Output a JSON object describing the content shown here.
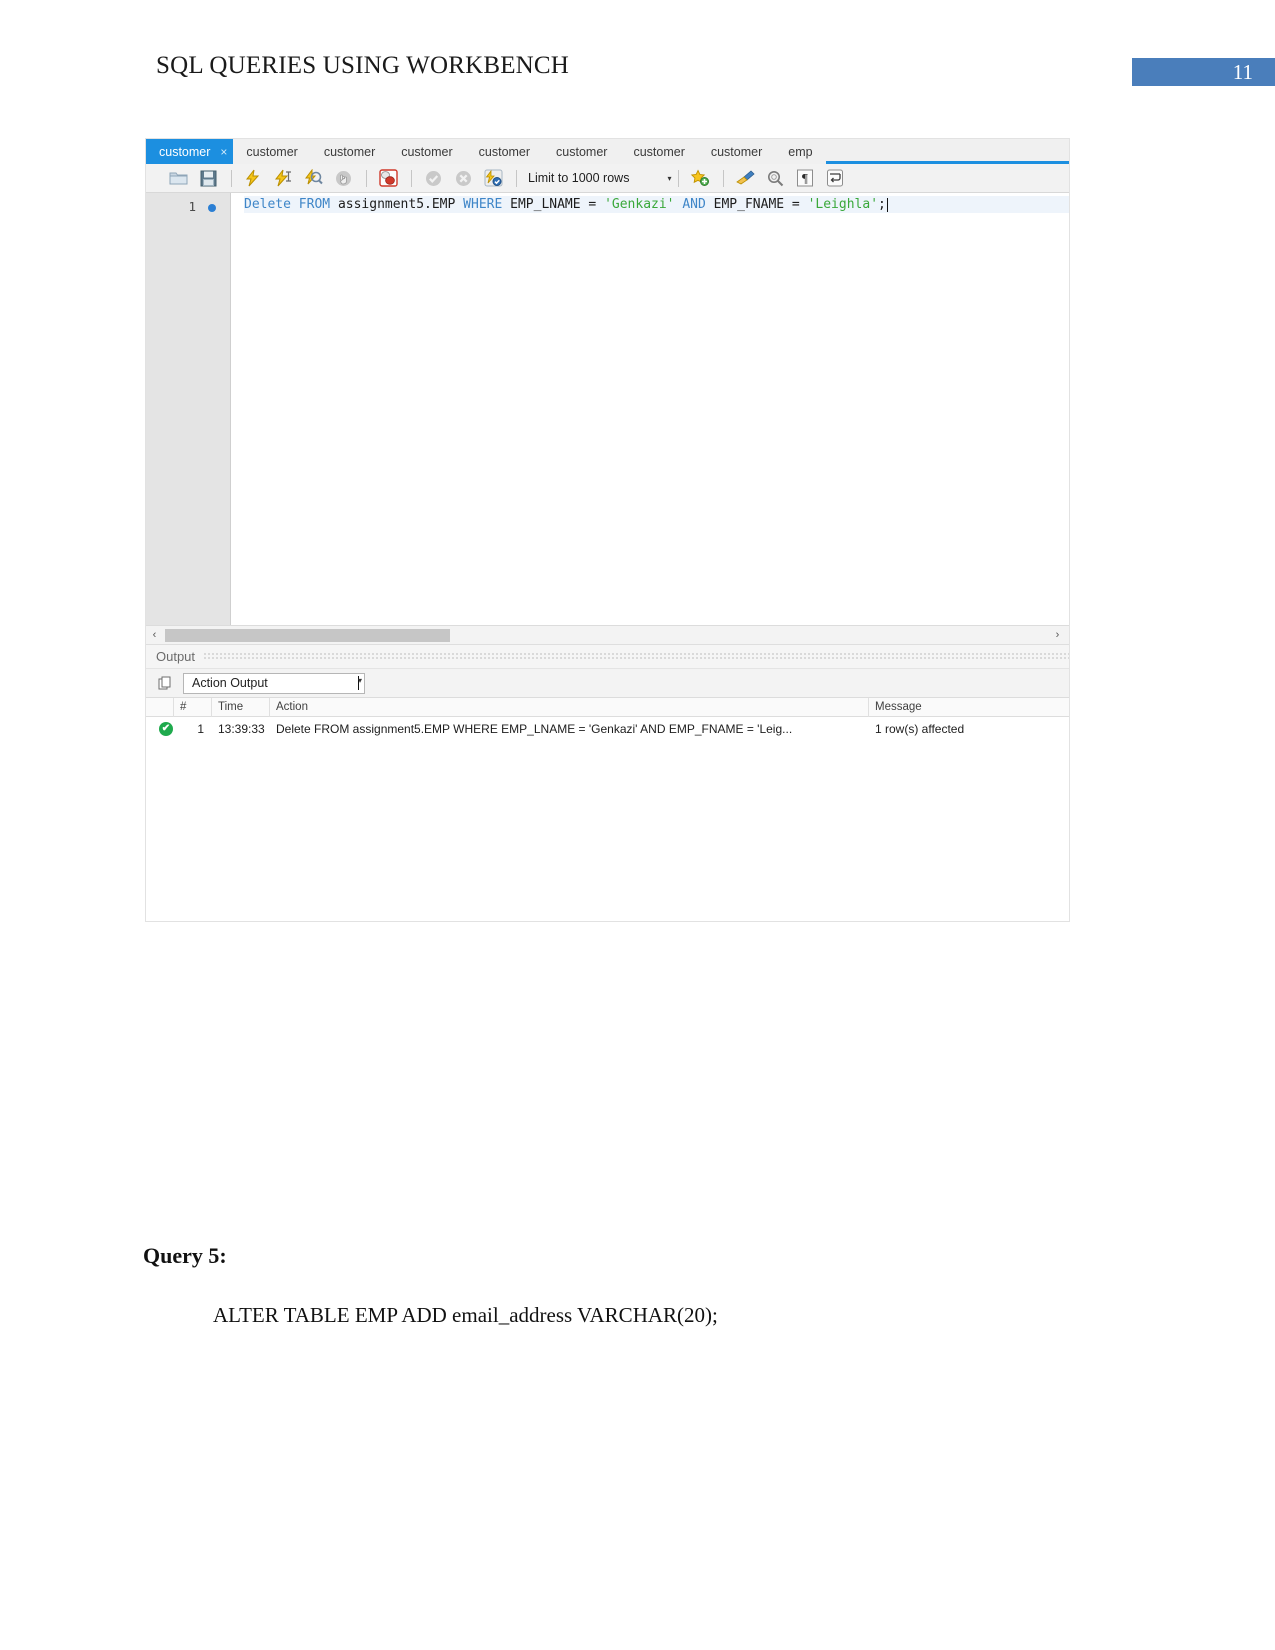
{
  "document": {
    "header_title": "SQL QUERIES USING WORKBENCH",
    "page_number": "11",
    "accent_color": "#4a7ebb",
    "query_label": "Query 5:",
    "query_text": "ALTER TABLE EMP ADD email_address VARCHAR(20);"
  },
  "workbench": {
    "tabs": [
      {
        "label": "customer",
        "active": true,
        "close": "×"
      },
      {
        "label": "customer",
        "active": false
      },
      {
        "label": "customer",
        "active": false
      },
      {
        "label": "customer",
        "active": false
      },
      {
        "label": "customer",
        "active": false
      },
      {
        "label": "customer",
        "active": false
      },
      {
        "label": "customer",
        "active": false
      },
      {
        "label": "customer",
        "active": false
      },
      {
        "label": "emp",
        "active": false
      }
    ],
    "toolbar": {
      "icons": [
        "open-sql-script-icon",
        "save-script-icon",
        "execute-statement-icon",
        "execute-current-statement-icon",
        "explain-query-icon",
        "stop-execution-icon",
        "toggle-stop-on-error-icon",
        "commit-icon",
        "rollback-icon",
        "toggle-autocommit-icon",
        "beautify-query-icon",
        "find-icon",
        "toggle-invisible-chars-icon",
        "wrap-lines-icon"
      ],
      "limit_label": "Limit to",
      "limit_value": "1000 rows",
      "limit_caret": "▾"
    },
    "editor": {
      "line_number": "1",
      "tokens": [
        {
          "text": "Delete ",
          "cls": "kw"
        },
        {
          "text": "FROM ",
          "cls": "kw"
        },
        {
          "text": "assignment5.EMP ",
          "cls": "plain"
        },
        {
          "text": "WHERE ",
          "cls": "kw"
        },
        {
          "text": "EMP_LNAME = ",
          "cls": "plain"
        },
        {
          "text": "'Genkazi' ",
          "cls": "str"
        },
        {
          "text": "AND ",
          "cls": "kw"
        },
        {
          "text": "EMP_FNAME = ",
          "cls": "plain"
        },
        {
          "text": "'Leighla'",
          "cls": "str"
        },
        {
          "text": ";",
          "cls": "plain"
        }
      ],
      "full_text": "Delete FROM assignment5.EMP WHERE EMP_LNAME = 'Genkazi' AND EMP_FNAME = 'Leighla';",
      "scroll_left_arrow": "‹",
      "scroll_right_arrow": "›"
    },
    "output_panel": {
      "title": "Output",
      "selector_value": "Action Output",
      "selector_caret": "▾",
      "columns": [
        "",
        "#",
        "Time",
        "Action",
        "Message"
      ],
      "rows": [
        {
          "status": "success",
          "status_glyph": "✔",
          "num": "1",
          "time": "13:39:33",
          "action": "Delete FROM assignment5.EMP WHERE EMP_LNAME = 'Genkazi' AND EMP_FNAME = 'Leig...",
          "message": "1 row(s) affected"
        }
      ]
    }
  }
}
